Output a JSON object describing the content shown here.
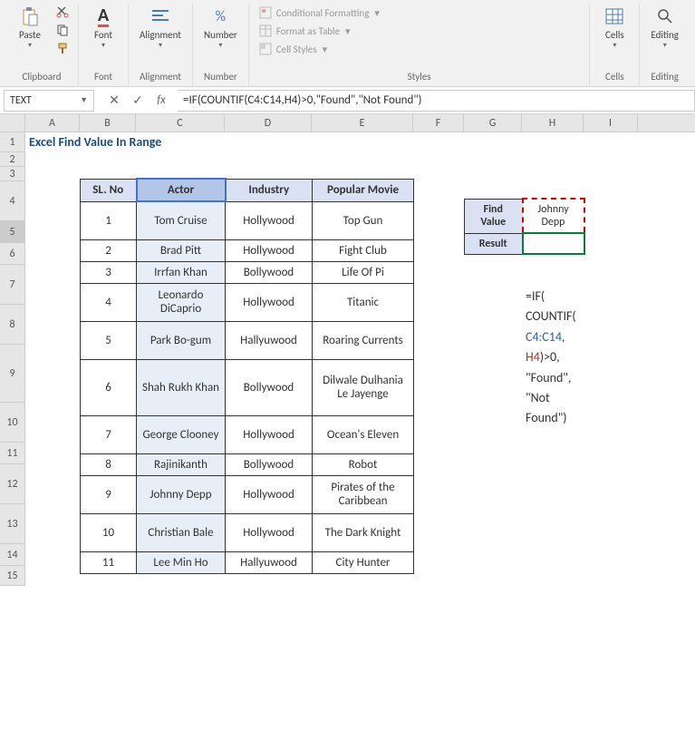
{
  "ribbon": {
    "clipboard": {
      "label": "Clipboard",
      "paste": "Paste"
    },
    "font": {
      "label": "Font",
      "btn": "Font"
    },
    "alignment": {
      "label": "Alignment",
      "btn": "Alignment"
    },
    "number": {
      "label": "Number",
      "btn": "Number"
    },
    "styles": {
      "label": "Styles",
      "conditional": "Conditional Formatting",
      "table": "Format as Table",
      "cell": "Cell Styles"
    },
    "cells": {
      "label": "Cells",
      "btn": "Cells"
    },
    "editing": {
      "label": "Editing",
      "btn": "Editing"
    }
  },
  "formula_bar": {
    "name_box": "TEXT",
    "formula": "=IF(COUNTIF(C4:C14,H4)>0,\"Found\",\"Not Found\")"
  },
  "sheet": {
    "title": "Excel Find Value In Range",
    "columns": [
      "A",
      "B",
      "C",
      "D",
      "E",
      "F",
      "G",
      "H",
      "I"
    ],
    "headers": {
      "slno": "SL. No",
      "actor": "Actor",
      "industry": "Industry",
      "movie": "Popular Movie"
    },
    "rows": [
      {
        "n": "1",
        "actor": "Tom Cruise",
        "ind": "Hollywood",
        "mv": "Top Gun"
      },
      {
        "n": "2",
        "actor": "Brad Pitt",
        "ind": "Hollywood",
        "mv": "Fight Club"
      },
      {
        "n": "3",
        "actor": "Irrfan Khan",
        "ind": "Bollywood",
        "mv": "Life Of Pi"
      },
      {
        "n": "4",
        "actor": "Leonardo DiCaprio",
        "ind": "Hollywood",
        "mv": "Titanic"
      },
      {
        "n": "5",
        "actor": "Park Bo-gum",
        "ind": "Hallyuwood",
        "mv": "Roaring Currents"
      },
      {
        "n": "6",
        "actor": "Shah Rukh Khan",
        "ind": "Bollywood",
        "mv": "Dilwale Dulhania Le Jayenge"
      },
      {
        "n": "7",
        "actor": "George Clooney",
        "ind": "Hollywood",
        "mv": "Ocean's Eleven"
      },
      {
        "n": "8",
        "actor": "Rajinikanth",
        "ind": "Bollywood",
        "mv": "Robot"
      },
      {
        "n": "9",
        "actor": "Johnny Depp",
        "ind": "Hollywood",
        "mv": "Pirates of the Caribbean"
      },
      {
        "n": "10",
        "actor": "Christian Bale",
        "ind": "Hollywood",
        "mv": "The Dark Knight"
      },
      {
        "n": "11",
        "actor": "Lee Min Ho",
        "ind": "Hallyuwood",
        "mv": "City Hunter"
      }
    ],
    "find": {
      "find_label": "Find Value",
      "result_label": "Result",
      "value": "Johnny Depp",
      "result": ""
    },
    "annotation": {
      "l1": "=IF(",
      "l2a": "COUNTIF(",
      "l3a": "C4:C14",
      "l3b": ",",
      "l4a": "H4",
      "l4b": ")>0,",
      "l5": "\"Found\",",
      "l6": "\"Not",
      "l7": "Found\")"
    }
  }
}
